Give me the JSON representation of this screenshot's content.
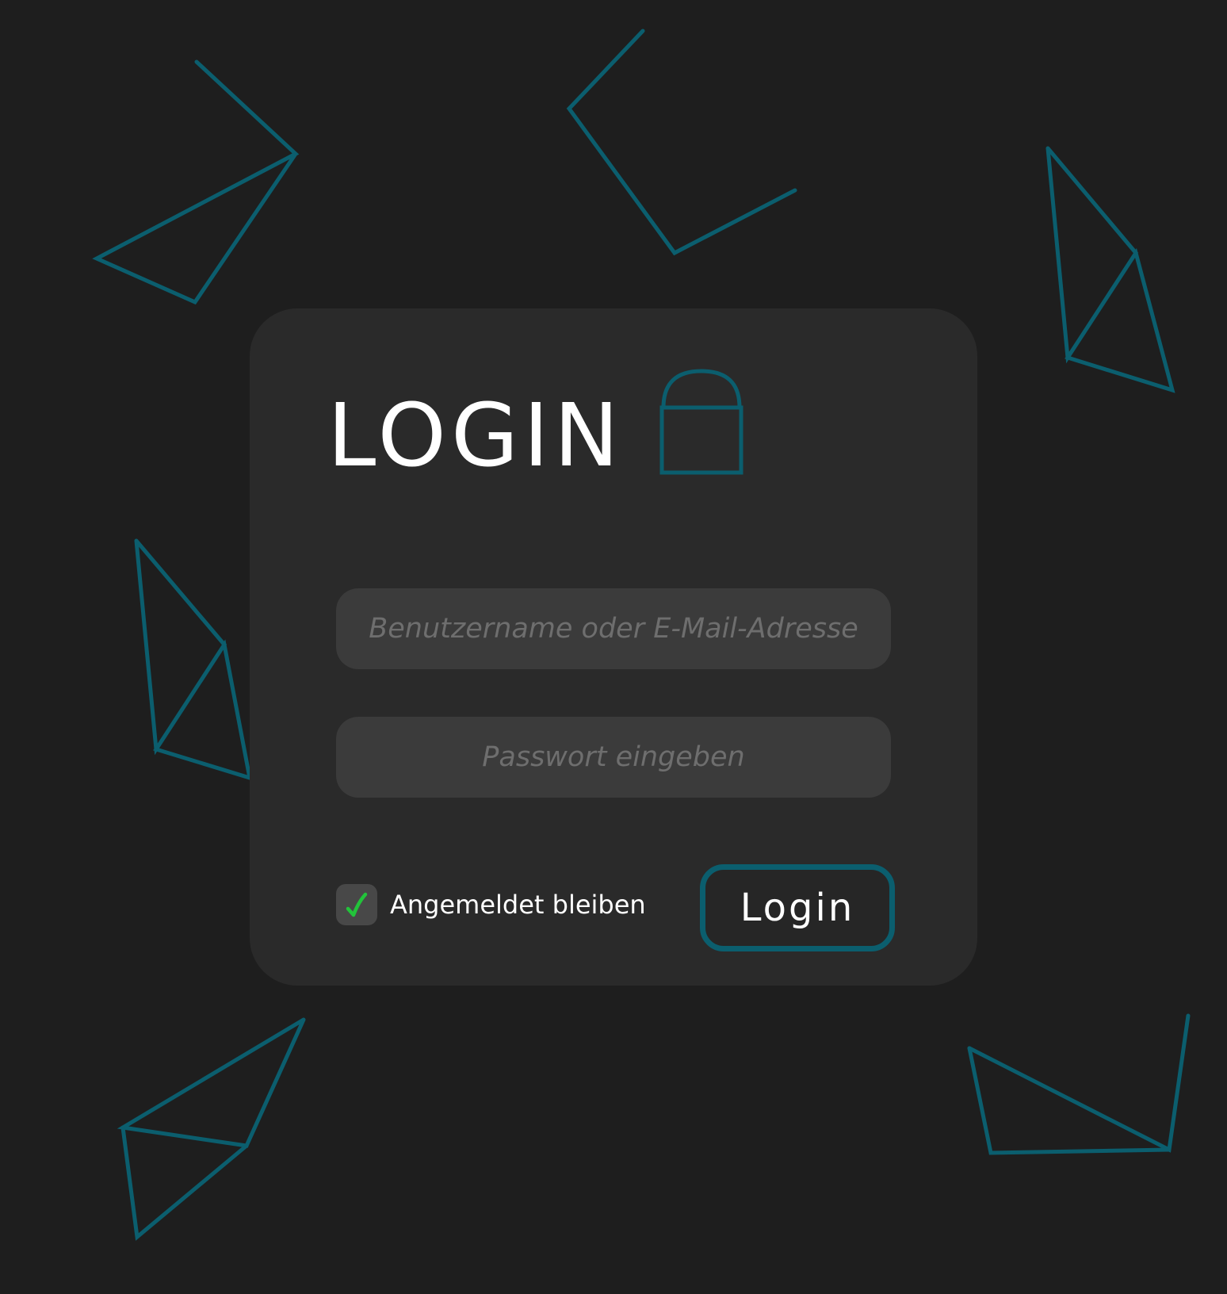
{
  "colors": {
    "background": "#1e1e1e",
    "card": "#2a2a2a",
    "input": "#3b3b3b",
    "accent": "#0b5e6e",
    "check": "#22c33a",
    "text": "#ffffff",
    "placeholder": "#6e6e6e"
  },
  "login_form": {
    "title": "LOGIN",
    "title_icon": "lock-icon",
    "username": {
      "value": "",
      "placeholder": "Benutzername oder E-Mail-Adresse"
    },
    "password": {
      "value": "",
      "placeholder": "Passwort eingeben"
    },
    "remember_me": {
      "label": "Angemeldet bleiben",
      "checked": true,
      "icon": "checkmark-icon"
    },
    "submit_label": "Login"
  },
  "background": {
    "decoration": "outline-triangle-shapes"
  }
}
